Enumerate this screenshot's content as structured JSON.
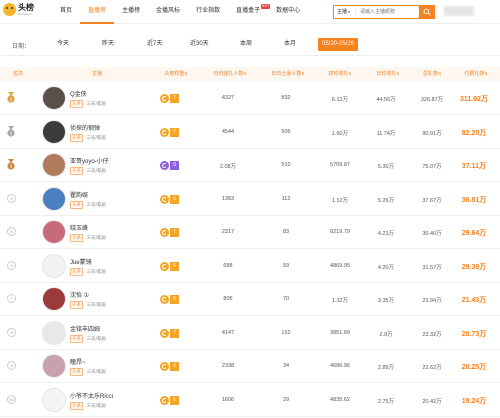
{
  "nav": {
    "logo_text": "头榜",
    "logo_sub": "toubang.tv",
    "items": [
      {
        "label": "首页",
        "active": false
      },
      {
        "label": "直播榜",
        "active": true
      },
      {
        "label": "主播榜",
        "active": false
      },
      {
        "label": "金播风标",
        "active": false
      },
      {
        "label": "行业指数",
        "active": false
      },
      {
        "label": "直播盒子",
        "active": false,
        "badge": "HOT"
      },
      {
        "label": "数据中心",
        "active": false
      }
    ]
  },
  "search": {
    "select_value": "主播",
    "placeholder": "请输入主播昵称"
  },
  "filter": {
    "label": "日期：",
    "options": [
      "今天",
      "昨天",
      "近7天",
      "近30天",
      "本周",
      "本月",
      "05/20-05/26"
    ],
    "active_index": 6
  },
  "table": {
    "columns": [
      "名次",
      "主播",
      "头榜权重",
      "日均送礼人数",
      "日均土豪人数",
      "初均收礼",
      "日均收礼",
      "总礼物",
      "付费礼物"
    ],
    "rows": [
      {
        "rank": "1",
        "name": "Q金侠",
        "tag": "头条",
        "category": "三农/家居",
        "weight": "7",
        "weight_color": "orange",
        "gift_users": "4327",
        "rich_users": "832",
        "avg_gift": "6.12万",
        "daily_gift": "44.56万",
        "total_gift": "326.87万",
        "paid_gift": "311.92万",
        "avatar_color": "#5a5048"
      },
      {
        "rank": "2",
        "name": "侦探的钢弹",
        "tag": "头条",
        "category": "三农/家居",
        "weight": "7",
        "weight_color": "orange",
        "gift_users": "4544",
        "rich_users": "505",
        "avg_gift": "1.60万",
        "daily_gift": "11.74万",
        "total_gift": "90.91万",
        "paid_gift": "82.20万",
        "avatar_color": "#3d3a3c"
      },
      {
        "rank": "3",
        "name": "亚哥yoyo-小仔",
        "tag": "头条",
        "category": "三农/家居",
        "weight": "9",
        "weight_color": "purple",
        "gift_users": "2.08万",
        "rich_users": "510",
        "avg_gift": "5709.87",
        "daily_gift": "5.30万",
        "total_gift": "75.07万",
        "paid_gift": "37.11万",
        "avatar_color": "#b07a5c"
      },
      {
        "rank": "4",
        "name": "瞿韵娱",
        "tag": "头条",
        "category": "三农/家居",
        "weight": "5",
        "weight_color": "orange",
        "gift_users": "1383",
        "rich_users": "112",
        "avg_gift": "1.12万",
        "daily_gift": "5.26万",
        "total_gift": "37.67万",
        "paid_gift": "36.81万",
        "avatar_color": "#4a7fc0"
      },
      {
        "rank": "5",
        "name": "晓玉峰",
        "tag": "头条",
        "category": "三农/家居",
        "weight": "7",
        "weight_color": "orange",
        "gift_users": "2317",
        "rich_users": "83",
        "avg_gift": "8219.79",
        "daily_gift": "4.23万",
        "total_gift": "30.40万",
        "paid_gift": "29.64万",
        "avatar_color": "#c86a7a"
      },
      {
        "rank": "6",
        "name": "Jue蒙镜",
        "tag": "头条",
        "category": "三农/家居",
        "weight": "6",
        "weight_color": "orange",
        "gift_users": "688",
        "rich_users": "59",
        "avg_gift": "4869.95",
        "daily_gift": "4.20万",
        "total_gift": "31.57万",
        "paid_gift": "29.39万",
        "avatar_color": "#f2f2f2"
      },
      {
        "rank": "7",
        "name": "沈怡 ①",
        "tag": "头条",
        "category": "三农/家居",
        "weight": "5",
        "weight_color": "orange",
        "gift_users": "805",
        "rich_users": "70",
        "avg_gift": "1.32万",
        "daily_gift": "3.35万",
        "total_gift": "23.94万",
        "paid_gift": "21.43万",
        "avatar_color": "#9a3a3a"
      },
      {
        "rank": "8",
        "name": "金铭丰四姆",
        "tag": "头条",
        "category": "三农/家居",
        "weight": "7",
        "weight_color": "orange",
        "gift_users": "4147",
        "rich_users": "152",
        "avg_gift": "3851.69",
        "daily_gift": "2.9万",
        "total_gift": "23.32万",
        "paid_gift": "20.73万",
        "avatar_color": "#e8e8e8"
      },
      {
        "rank": "9",
        "name": "瞳昂~",
        "tag": "头条",
        "category": "三农/家居",
        "weight": "6",
        "weight_color": "orange",
        "gift_users": "2338",
        "rich_users": "34",
        "avg_gift": "4686.96",
        "daily_gift": "2.89万",
        "total_gift": "22.62万",
        "paid_gift": "20.25万",
        "avatar_color": "#c9a0b0"
      },
      {
        "rank": "10",
        "name": "小爷不太乐Ricci",
        "tag": "头条",
        "category": "三农/家居",
        "weight": "6",
        "weight_color": "orange",
        "gift_users": "1606",
        "rich_users": "29",
        "avg_gift": "4835.62",
        "daily_gift": "2.75万",
        "total_gift": "20.42万",
        "paid_gift": "19.24万",
        "avatar_color": "#f4f4f4"
      }
    ]
  },
  "colors": {
    "accent": "#f5811f",
    "gold": "#e0a040",
    "silver": "#a8a8a8",
    "bronze": "#d08840",
    "weight_orange": "#f5a524",
    "weight_purple": "#8c5fe0"
  }
}
